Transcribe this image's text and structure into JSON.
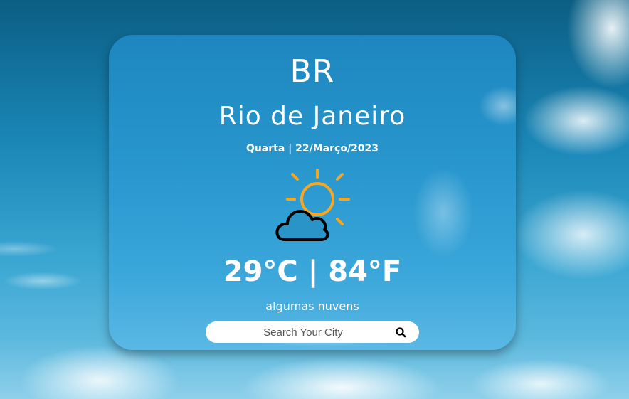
{
  "weather": {
    "country": "BR",
    "city": "Rio de Janeiro",
    "date": "Quarta | 22/Março/2023",
    "icon": "partly-cloudy-icon",
    "temperature": "29°C | 84°F",
    "description": "algumas nuvens"
  },
  "search": {
    "placeholder": "Search Your City",
    "icon": "search-icon"
  },
  "colors": {
    "sun": "#f5a623",
    "cloud_outline": "#000000",
    "text": "#ffffff"
  }
}
